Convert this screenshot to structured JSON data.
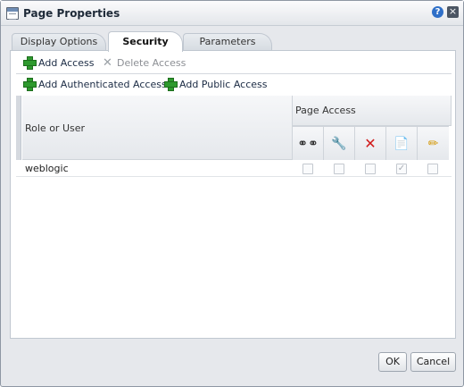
{
  "window": {
    "title": "Page Properties"
  },
  "tabs": [
    {
      "label": "Display Options",
      "active": false
    },
    {
      "label": "Security",
      "active": true
    },
    {
      "label": "Parameters",
      "active": false
    }
  ],
  "toolbar": {
    "add_access": "Add Access",
    "delete_access": "Delete Access",
    "add_authenticated_access": "Add Authenticated Access",
    "add_public_access": "Add Public Access"
  },
  "table": {
    "headers": {
      "role_or_user": "Role or User",
      "page_access": "Page Access"
    },
    "permission_icons": [
      "view-glasses-icon",
      "customize-wrench-icon",
      "delete-x-icon",
      "manage-pages-icon",
      "edit-pencil-icon"
    ],
    "rows": [
      {
        "name": "weblogic",
        "permissions": [
          false,
          false,
          false,
          true,
          false
        ]
      }
    ]
  },
  "footer": {
    "ok": "OK",
    "cancel": "Cancel"
  }
}
